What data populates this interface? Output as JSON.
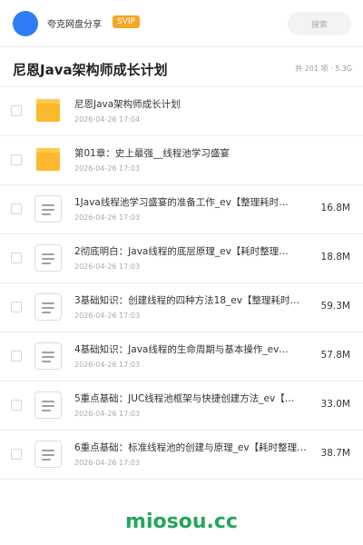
{
  "topbar": {
    "app_name": "夸克网盘分享",
    "badge": "SVIP",
    "search_placeholder": "搜索",
    "accent_color": "#2f7cf6",
    "badge_color": "#f5a623"
  },
  "header": {
    "title": "尼恩Java架构师成长计划",
    "summary": "共 201 项 · 5.3G"
  },
  "items": [
    {
      "type": "folder",
      "icon": "folder-icon",
      "name": "尼恩Java架构师成长计划",
      "date": "2026-04-26 17:04",
      "size": ""
    },
    {
      "type": "folder",
      "icon": "folder-icon",
      "name": "第01章：史上最强__线程池学习盛宴",
      "date": "2026-04-26 17:03",
      "size": ""
    },
    {
      "type": "file",
      "icon": "document-icon",
      "name": "1Java线程池学习盛宴的准备工作_ev【整理耗时…",
      "date": "2026-04-26 17:03",
      "size": "16.8M"
    },
    {
      "type": "file",
      "icon": "document-icon",
      "name": "2彻底明白：Java线程的底层原理_ev【耗时整理…",
      "date": "2026-04-26 17:03",
      "size": "18.8M"
    },
    {
      "type": "file",
      "icon": "document-icon",
      "name": "3基础知识：创建线程的四种方法18_ev【整理耗时…",
      "date": "2026-04-26 17:03",
      "size": "59.3M"
    },
    {
      "type": "file",
      "icon": "document-icon",
      "name": "4基础知识：Java线程的生命周期与基本操作_ev…",
      "date": "2026-04-26 17:03",
      "size": "57.8M"
    },
    {
      "type": "file",
      "icon": "document-icon",
      "name": "5重点基础：JUC线程池框架与快捷创建方法_ev【…",
      "date": "2026-04-26 17:03",
      "size": "33.0M"
    },
    {
      "type": "file",
      "icon": "document-icon",
      "name": "6重点基础：标准线程池的创建与原理_ev【耗时整理…",
      "date": "2026-04-26 17:03",
      "size": "38.7M"
    }
  ],
  "watermark": "miosou.cc",
  "watermark_color": "#25a65b"
}
